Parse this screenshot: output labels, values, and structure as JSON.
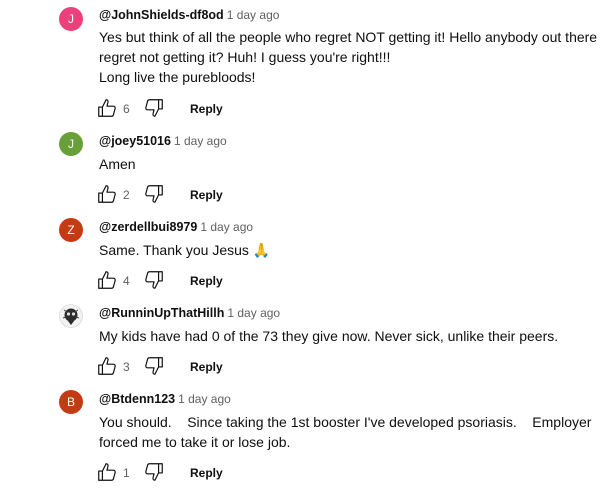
{
  "comments": [
    {
      "avatar_letter": "J",
      "avatar_color": "#ec407a",
      "handle": "@JohnShields-df8od",
      "time": "1 day ago",
      "lines": [
        "Yes but think of all the people who regret NOT getting it! Hello anybody out there",
        "regret not getting it? Huh! I guess you're right!!!",
        "Long live the purebloods!"
      ],
      "likes": "6",
      "reply_label": "Reply"
    },
    {
      "avatar_letter": "J",
      "avatar_color": "#689f38",
      "handle": "@joey51016",
      "time": "1 day ago",
      "lines": [
        "Amen"
      ],
      "likes": "2",
      "reply_label": "Reply"
    },
    {
      "avatar_letter": "Z",
      "avatar_color": "#c33a13",
      "handle": "@zerdellbui8979",
      "time": "1 day ago",
      "lines": [
        "Same. Thank you Jesus 🙏"
      ],
      "likes": "4",
      "reply_label": "Reply"
    },
    {
      "avatar_letter": "",
      "avatar_color": "#5a5a5a",
      "handle": "@RunninUpThatHillh",
      "time": "1 day ago",
      "lines": [
        "My kids have had 0 of the 73 they give now. Never sick,  unlike their peers."
      ],
      "likes": "3",
      "reply_label": "Reply"
    },
    {
      "avatar_letter": "B",
      "avatar_color": "#c33a13",
      "handle": "@Btdenn123",
      "time": "1 day ago",
      "lines": [
        "You should.    Since taking the 1st booster I've developed psoriasis.    Employer",
        "forced me to take it or lose job."
      ],
      "likes": "1",
      "reply_label": "Reply"
    }
  ],
  "icons": {
    "like": "thumbs-up-icon",
    "dislike": "thumbs-down-icon"
  }
}
